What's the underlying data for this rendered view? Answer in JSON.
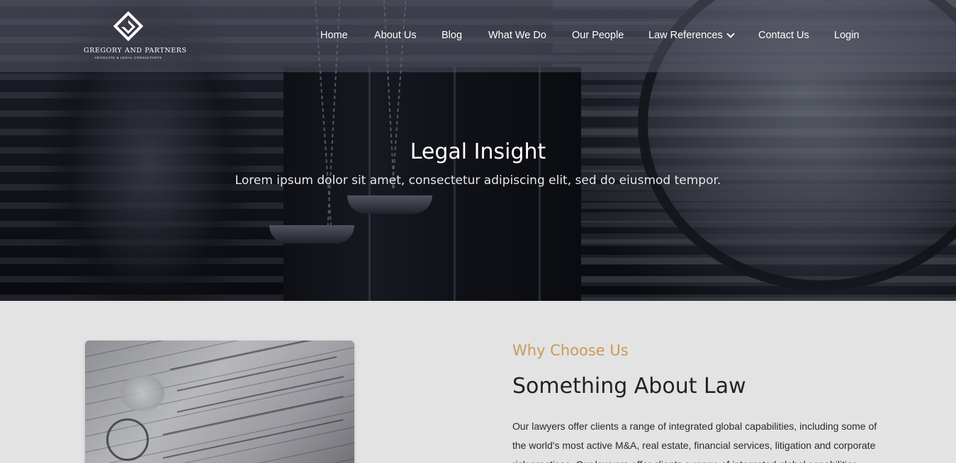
{
  "brand": {
    "name": "GREGORY AND PARTNERS",
    "tagline": "ADVOCATE & LEGAL CONSULTANTS"
  },
  "nav": {
    "items": [
      {
        "label": "Home"
      },
      {
        "label": "About Us"
      },
      {
        "label": "Blog"
      },
      {
        "label": "What We Do"
      },
      {
        "label": "Our People"
      },
      {
        "label": "Law References",
        "has_dropdown": true
      },
      {
        "label": "Contact Us"
      },
      {
        "label": "Login"
      }
    ]
  },
  "hero": {
    "title": "Legal Insight",
    "subtitle": "Lorem ipsum dolor sit amet, consectetur adipiscing elit, sed do eiusmod tempor."
  },
  "about": {
    "kicker": "Why Choose Us",
    "title": "Something About Law",
    "body": "Our lawyers offer clients a range of integrated global capabilities, including some of the world's most active M&A, real estate, financial services, litigation and corporate risk practices. Our lawyers offer clients a range of integrated global capabilities"
  },
  "colors": {
    "accent": "#c89a5a",
    "heading": "#222222",
    "section_bg": "#e3e3e3"
  },
  "icons": {
    "logo": "diamond-g-logo-icon",
    "dropdown": "chevron-down-icon"
  }
}
